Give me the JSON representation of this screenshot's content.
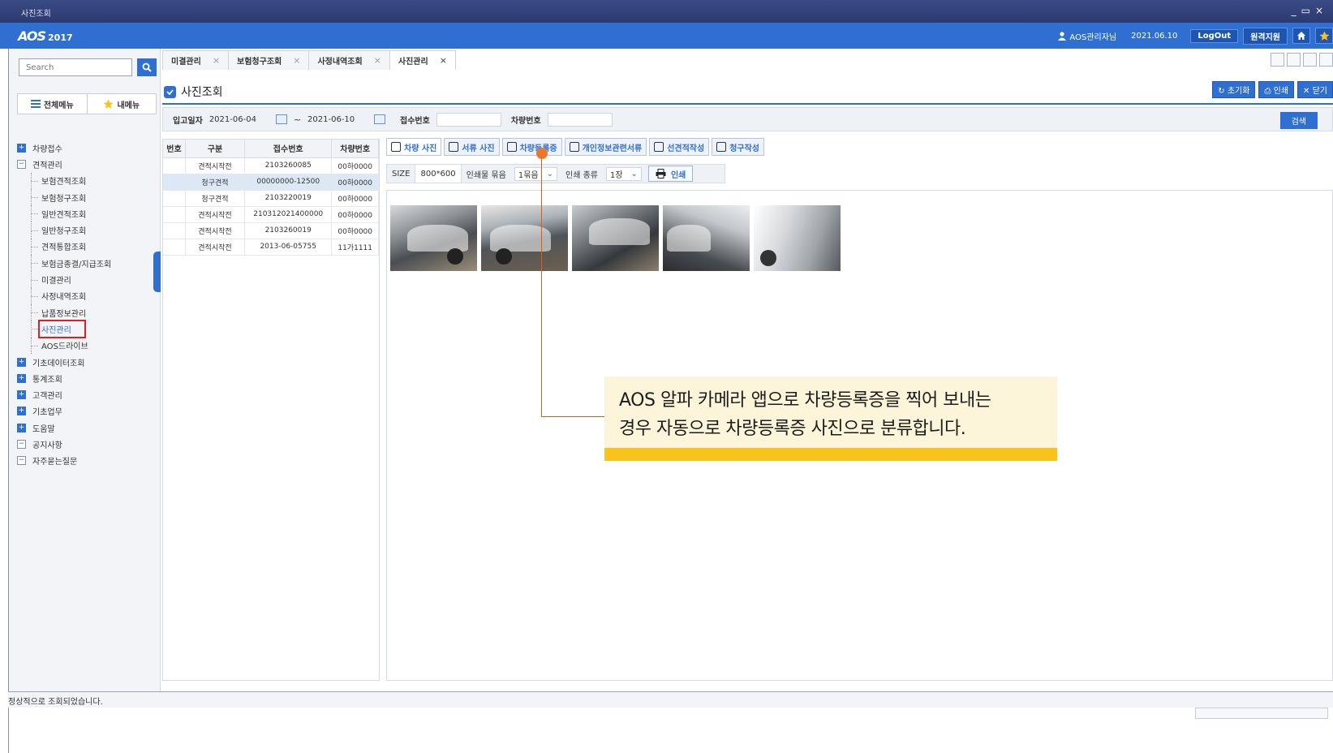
{
  "window": {
    "title": "사진조회"
  },
  "app": {
    "logo": "AOS",
    "logo_year": "2017",
    "user": "AOS관리자님",
    "date": "2021.06.10",
    "logout": "LogOut",
    "remote_support": "원격지원"
  },
  "sidebar": {
    "search_placeholder": "Search",
    "tab_all_menu": "전체메뉴",
    "tab_my_menu": "내메뉴",
    "tree": [
      {
        "label": "차량접수",
        "type": "plus"
      },
      {
        "label": "견적관리",
        "type": "minus"
      },
      {
        "label": "보험견적조회",
        "type": "child"
      },
      {
        "label": "보험청구조회",
        "type": "child"
      },
      {
        "label": "일반견적조회",
        "type": "child"
      },
      {
        "label": "일반청구조회",
        "type": "child"
      },
      {
        "label": "견적통합조회",
        "type": "child"
      },
      {
        "label": "보험금종결/지급조회",
        "type": "child"
      },
      {
        "label": "미결관리",
        "type": "child"
      },
      {
        "label": "사정내역조회",
        "type": "child"
      },
      {
        "label": "납품정보관리",
        "type": "child"
      },
      {
        "label": "사진관리",
        "type": "child-selected"
      },
      {
        "label": "AOS드라이브",
        "type": "child"
      },
      {
        "label": "기초데이터조회",
        "type": "plus"
      },
      {
        "label": "통계조회",
        "type": "plus"
      },
      {
        "label": "고객관리",
        "type": "plus"
      },
      {
        "label": "기초업무",
        "type": "plus"
      },
      {
        "label": "도움말",
        "type": "plus"
      },
      {
        "label": "공지사항",
        "type": "minus"
      },
      {
        "label": "자주묻는질문",
        "type": "minus"
      }
    ]
  },
  "doc_tabs": [
    {
      "label": "미결관리",
      "active": false
    },
    {
      "label": "보험청구조회",
      "active": false
    },
    {
      "label": "사정내역조회",
      "active": false
    },
    {
      "label": "사진관리",
      "active": true
    }
  ],
  "page": {
    "title": "사진조회",
    "btn_reset": "초기화",
    "btn_print": "인쇄",
    "btn_close": "닫기"
  },
  "filter": {
    "label_date": "입고일자",
    "date_from": "2021-06-04",
    "tilde": "~",
    "date_to": "2021-06-10",
    "label_receipt": "접수번호",
    "label_car": "차량번호",
    "search": "검색"
  },
  "table": {
    "headers": [
      "번호",
      "구분",
      "접수번호",
      "차량번호"
    ],
    "rows": [
      {
        "no": "",
        "type": "견적시작전",
        "receipt": "2103260085",
        "car": "00하0000",
        "selected": false
      },
      {
        "no": "",
        "type": "청구견적",
        "receipt": "00000000-12500",
        "car": "00하0000",
        "selected": true
      },
      {
        "no": "",
        "type": "청구견적",
        "receipt": "2103220019",
        "car": "00하0000",
        "selected": false
      },
      {
        "no": "",
        "type": "견적시작전",
        "receipt": "210312021400000",
        "car": "00하0000",
        "selected": false
      },
      {
        "no": "",
        "type": "견적시작전",
        "receipt": "2103260019",
        "car": "00하0000",
        "selected": false
      },
      {
        "no": "",
        "type": "견적시작전",
        "receipt": "2013-06-05755",
        "car": "11가1111",
        "selected": false
      }
    ]
  },
  "photo_tabs": [
    {
      "label": "차량 사진",
      "icon": "camera-icon"
    },
    {
      "label": "서류 사진",
      "icon": "document-icon"
    },
    {
      "label": "차량등록증",
      "icon": "document-icon"
    },
    {
      "label": "개인정보관련서류",
      "icon": "document-icon"
    },
    {
      "label": "선견적작성",
      "icon": "edit-icon"
    },
    {
      "label": "청구작성",
      "icon": "edit-icon"
    }
  ],
  "print_bar": {
    "size_label": "SIZE",
    "size_value": "800*600",
    "bundle_label": "인쇄물 묶음",
    "bundle_value": "1묶음",
    "kind_label": "인쇄 종류",
    "kind_value": "1장",
    "print_button": "인쇄"
  },
  "callout": {
    "line1": "AOS 알파 카메라 앱으로 차량등록증을 찍어 보내는",
    "line2": "경우 자동으로 차량등록증 사진으로 분류합니다."
  },
  "status": {
    "message": "정상적으로 조회되었습니다."
  },
  "colors": {
    "accent": "#2f6fd1",
    "callout_bg": "#fdf5d9",
    "callout_bar": "#f9c31b",
    "annotation": "#e8782c",
    "highlight": "#e02020"
  }
}
